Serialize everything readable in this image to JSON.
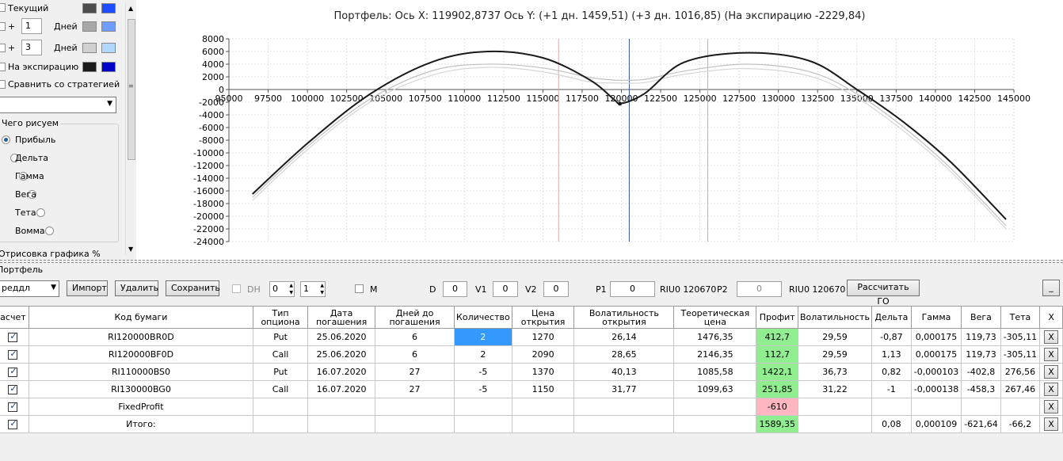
{
  "left_panel": {
    "current_label": "Текущий",
    "plus1": {
      "sign": "+",
      "value": "1",
      "unit": "Дней"
    },
    "plus3": {
      "sign": "+",
      "value": "3",
      "unit": "Дней"
    },
    "expiry_label": "На экспирацию",
    "compare_label": "Сравнить со стратегией",
    "group_title": "Чего рисуем",
    "radios": [
      "Прибыль",
      "Дельта",
      "Гамма",
      "Вега",
      "Тета",
      "Вомма"
    ],
    "selected_radio": "Прибыль",
    "bottom_label": "Отрисовка графика %",
    "colors": {
      "current": [
        "#4d4d4d",
        "#1e4cff"
      ],
      "plus1": [
        "#a8a8a8",
        "#6f9cff"
      ],
      "plus3": [
        "#d0d0d0",
        "#b0d8ff"
      ],
      "expiry": [
        "#1a1a1a",
        "#0000c8"
      ]
    }
  },
  "chart": {
    "title": "Портфель: Ось X:  119902,8737 Ось Y:  (+1 дн. 1459,51)  (+3 дн. 1016,85)  (На экспирацию -2229,84)"
  },
  "chart_data": {
    "type": "line",
    "x_range": [
      95000,
      145000
    ],
    "y_range": [
      -24000,
      8000
    ],
    "x_ticks": [
      "95000",
      "97500",
      "100000",
      "102500",
      "105000",
      "107500",
      "110000",
      "112500",
      "115000",
      "117500",
      "120000",
      "122500",
      "125000",
      "127500",
      "130000",
      "132500",
      "135000",
      "137500",
      "140000",
      "142500",
      "145000"
    ],
    "y_ticks": [
      "8000",
      "6000",
      "4000",
      "2000",
      "0",
      "-2000",
      "-4000",
      "-6000",
      "-8000",
      "-10000",
      "-12000",
      "-14000",
      "-16000",
      "-18000",
      "-20000",
      "-22000",
      "-24000"
    ],
    "grid": true,
    "vertical_markers": [
      {
        "x": 116000,
        "color": "#ff9999"
      },
      {
        "x": 120500,
        "color": "#3355aa"
      },
      {
        "x": 125500,
        "color": "#ff9999"
      }
    ],
    "series": [
      {
        "color": "#1a1a1a",
        "width": 2,
        "x": [
          96500,
          100000,
          104000,
          108000,
          111500,
          115000,
          118000,
          119500,
          120000,
          121500,
          124000,
          128000,
          132000,
          135000,
          138000,
          141000,
          144500
        ],
        "y": [
          -16500,
          -8500,
          -700,
          4400,
          6000,
          5000,
          1500,
          -1500,
          -2200,
          -600,
          4300,
          5800,
          4500,
          0,
          -5200,
          -11500,
          -20500
        ]
      },
      {
        "color": "#c0c0c0",
        "width": 1.2,
        "x": [
          96500,
          100000,
          104000,
          108000,
          111500,
          115000,
          118000,
          119500,
          120000,
          121500,
          124000,
          128000,
          132000,
          135000,
          138000,
          141000,
          144500
        ],
        "y": [
          -17000,
          -9000,
          -1500,
          3000,
          4000,
          3400,
          1900,
          1500,
          1460,
          1600,
          2900,
          4000,
          2800,
          -700,
          -6000,
          -12500,
          -21500
        ]
      },
      {
        "color": "#d6d6d6",
        "width": 1.2,
        "x": [
          96500,
          100000,
          104000,
          108000,
          111500,
          115000,
          118000,
          119500,
          120000,
          121500,
          124000,
          128000,
          132000,
          135000,
          138000,
          141000,
          144500
        ],
        "y": [
          -17500,
          -9500,
          -2000,
          2300,
          3500,
          2800,
          1200,
          1050,
          1020,
          1100,
          2400,
          3300,
          2100,
          -1300,
          -6600,
          -13000,
          -22000
        ]
      }
    ]
  },
  "portfolio": {
    "label": "Портфель",
    "combo_value": "реддл",
    "import_btn": "Импорт",
    "delete_btn": "Удалить",
    "save_btn": "Сохранить",
    "dh_label": "DH",
    "spin1": "0",
    "spin2": "1",
    "m_label": "M",
    "d_label": "D",
    "d_value": "0",
    "v1_label": "V1",
    "v1_value": "0",
    "v2_label": "V2",
    "v2_value": "0",
    "p1_label": "P1",
    "p1_value": "0",
    "riu1": "RIU0 120670",
    "p2_label": "P2",
    "p2_value": "0",
    "riu2": "RIU0 120670",
    "calc_go_btn": "Рассчитать ГО",
    "minimize_btn": "_"
  },
  "table": {
    "headers": [
      "асчет",
      "Код бумаги",
      "Тип опциона",
      "Дата погашения",
      "Дней до погашения",
      "Количество",
      "Цена открытия",
      "Волатильность открытия",
      "Теоретическая цена",
      "Профит",
      "Волатильность",
      "Дельта",
      "Гамма",
      "Вега",
      "Тета",
      "X"
    ],
    "rows": [
      [
        "",
        "RI120000BR0D",
        "Put",
        "25.06.2020",
        "6",
        "2",
        "1270",
        "26,14",
        "1476,35",
        "412,7",
        "29,59",
        "-0,87",
        "0,000175",
        "119,73",
        "-305,11",
        "X"
      ],
      [
        "",
        "RI120000BF0D",
        "Call",
        "25.06.2020",
        "6",
        "2",
        "2090",
        "28,65",
        "2146,35",
        "112,7",
        "29,59",
        "1,13",
        "0,000175",
        "119,73",
        "-305,11",
        "X"
      ],
      [
        "",
        "RI110000BS0",
        "Put",
        "16.07.2020",
        "27",
        "-5",
        "1370",
        "40,13",
        "1085,58",
        "1422,1",
        "36,73",
        "0,82",
        "-0,000103",
        "-402,8",
        "276,56",
        "X"
      ],
      [
        "",
        "RI130000BG0",
        "Call",
        "16.07.2020",
        "27",
        "-5",
        "1150",
        "31,77",
        "1099,63",
        "251,85",
        "31,22",
        "-1",
        "-0,000138",
        "-458,3",
        "267,46",
        "X"
      ],
      [
        "",
        "FixedProfit",
        "",
        "",
        "",
        "",
        "",
        "",
        "",
        "-610",
        "",
        "",
        "",
        "",
        "",
        "X"
      ],
      [
        "",
        "Итого:",
        "",
        "",
        "",
        "",
        "",
        "",
        "",
        "1589,35",
        "",
        "0,08",
        "0,000109",
        "-621,64",
        "-66,2",
        "X"
      ]
    ]
  }
}
